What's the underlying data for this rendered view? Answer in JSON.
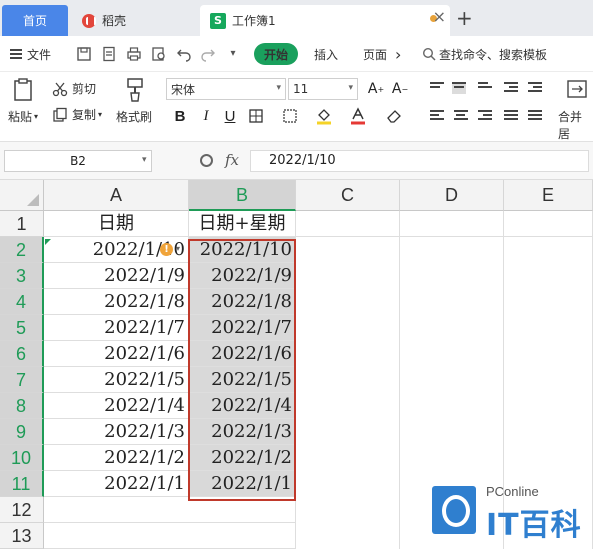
{
  "tabs": {
    "home": "首页",
    "daoke": "稻壳",
    "workbook": "工作簿1",
    "workbook_icon": "S",
    "add": "+",
    "close": "×"
  },
  "menu": {
    "file": "文件",
    "start": "开始",
    "insert": "插入",
    "page": "页面",
    "more": "›",
    "search": "查找命令、搜索模板"
  },
  "ribbon": {
    "paste": "粘贴",
    "cut": "剪切",
    "copy": "复制",
    "format_painter": "格式刷",
    "font_name": "宋体",
    "font_size": "11",
    "bold": "B",
    "italic": "I",
    "underline": "U",
    "merge_center": "合并居"
  },
  "formula_bar": {
    "cell_ref": "B2",
    "fx": "fx",
    "value": "2022/1/10"
  },
  "sheet": {
    "columns": [
      "A",
      "B",
      "C",
      "D",
      "E"
    ],
    "selected_column": "B",
    "rows": [
      "1",
      "2",
      "3",
      "4",
      "5",
      "6",
      "7",
      "8",
      "9",
      "10",
      "11",
      "12",
      "13"
    ],
    "header_row": {
      "A": "日期",
      "B": "日期+星期"
    },
    "data": [
      {
        "A": "2022/1/10",
        "B": "2022/1/10"
      },
      {
        "A": "2022/1/9",
        "B": "2022/1/9"
      },
      {
        "A": "2022/1/8",
        "B": "2022/1/8"
      },
      {
        "A": "2022/1/7",
        "B": "2022/1/7"
      },
      {
        "A": "2022/1/6",
        "B": "2022/1/6"
      },
      {
        "A": "2022/1/5",
        "B": "2022/1/5"
      },
      {
        "A": "2022/1/4",
        "B": "2022/1/4"
      },
      {
        "A": "2022/1/3",
        "B": "2022/1/3"
      },
      {
        "A": "2022/1/2",
        "B": "2022/1/2"
      },
      {
        "A": "2022/1/1",
        "B": "2022/1/1"
      }
    ]
  },
  "watermark": {
    "brand_small": "PConline",
    "brand_big": "IT百科"
  },
  "colors": {
    "tab_active": "#4a86e8",
    "start_button": "#1aa05d",
    "selection_border": "#c0392b",
    "selected_header": "#1f9b57",
    "watermark": "#2f7fcf"
  }
}
